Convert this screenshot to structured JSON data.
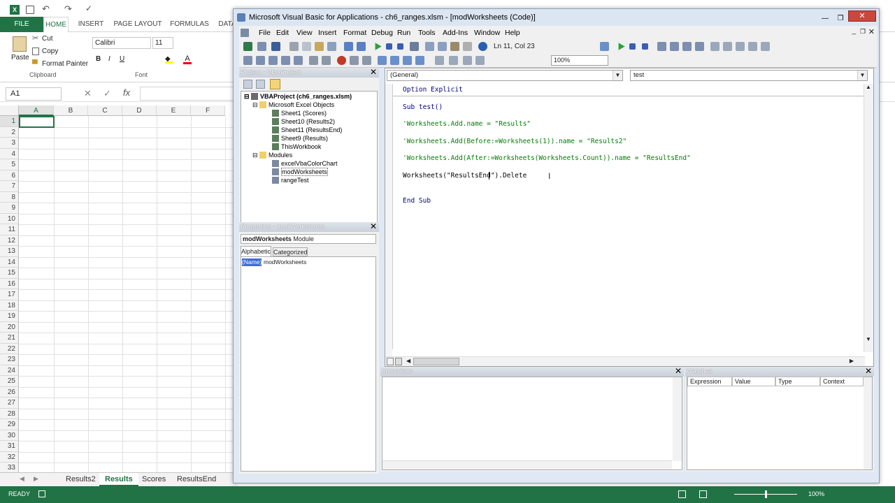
{
  "excel": {
    "tabs": [
      "FILE",
      "HOME",
      "INSERT",
      "PAGE LAYOUT",
      "FORMULAS",
      "DATA"
    ],
    "clipboard": {
      "paste": "Paste",
      "cut": "Cut",
      "copy": "Copy",
      "format_painter": "Format Painter",
      "group": "Clipboard"
    },
    "font": {
      "name": "Calibri",
      "size": "11",
      "group": "Font",
      "bold": "B",
      "italic": "I",
      "underline": "U"
    },
    "name_box": "A1",
    "formula_icons": {
      "cancel": "✕",
      "enter": "✓",
      "fx": "fx"
    },
    "columns": [
      "A",
      "B",
      "C",
      "D",
      "E",
      "F"
    ],
    "rows": [
      "1",
      "2",
      "3",
      "4",
      "5",
      "6",
      "7",
      "8",
      "9",
      "10",
      "11",
      "12",
      "13",
      "14",
      "15",
      "16",
      "17",
      "18",
      "19",
      "20",
      "21",
      "22",
      "23",
      "24",
      "25",
      "26",
      "27",
      "28",
      "29",
      "30",
      "31",
      "32",
      "33"
    ],
    "sheets": [
      "Results2",
      "Results",
      "Scores",
      "ResultsEnd"
    ],
    "active_sheet": "Results",
    "status": "READY",
    "zoom": "100%",
    "colors": {
      "brand": "#217346"
    }
  },
  "vbe": {
    "title": "Microsoft Visual Basic for Applications - ch6_ranges.xlsm - [modWorksheets (Code)]",
    "menu": [
      "File",
      "Edit",
      "View",
      "Insert",
      "Format",
      "Debug",
      "Run",
      "Tools",
      "Add-Ins",
      "Window",
      "Help"
    ],
    "cursor_pos": "Ln 11, Col 23",
    "zoom": "100%",
    "project": {
      "header": "Project - VBAProject",
      "root": "VBAProject (ch6_ranges.xlsm)",
      "excel_objects": "Microsoft Excel Objects",
      "sheets": [
        "Sheet1 (Scores)",
        "Sheet10 (Results2)",
        "Sheet11 (ResultsEnd)",
        "Sheet9 (Results)",
        "ThisWorkbook"
      ],
      "modules_label": "Modules",
      "modules": [
        "excelVbaColorChart",
        "modWorksheets",
        "rangeTest"
      ]
    },
    "properties": {
      "header": "Properties - modWorksheets",
      "object_name": "modWorksheets",
      "object_type": "Module",
      "tab_alpha": "Alphabetic",
      "tab_cat": "Categorized",
      "prop_name": "(Name)",
      "prop_value": "modWorksheets"
    },
    "code": {
      "object_combo": "(General)",
      "proc_combo": "test",
      "lines": [
        {
          "text": "Option Explicit",
          "kind": "kw"
        },
        {
          "text": "Sub test()",
          "kind": "kw"
        },
        {
          "text": "'Worksheets.Add.name = \"Results\"",
          "kind": "cm"
        },
        {
          "text": "'Worksheets.Add(Before:=Worksheets(1)).name = \"Results2\"",
          "kind": "cm"
        },
        {
          "text": "'Worksheets.Add(After:=Worksheets(Worksheets.Count)).name = \"ResultsEnd\"",
          "kind": "cm"
        },
        {
          "text": "Worksheets(\"ResultsEnd\").Delete",
          "kind": "tx"
        },
        {
          "text": "End Sub",
          "kind": "kw"
        }
      ]
    },
    "immediate": "Immediate",
    "watches": {
      "header": "Watches",
      "columns": [
        "Expression",
        "Value",
        "Type",
        "Context"
      ]
    }
  }
}
